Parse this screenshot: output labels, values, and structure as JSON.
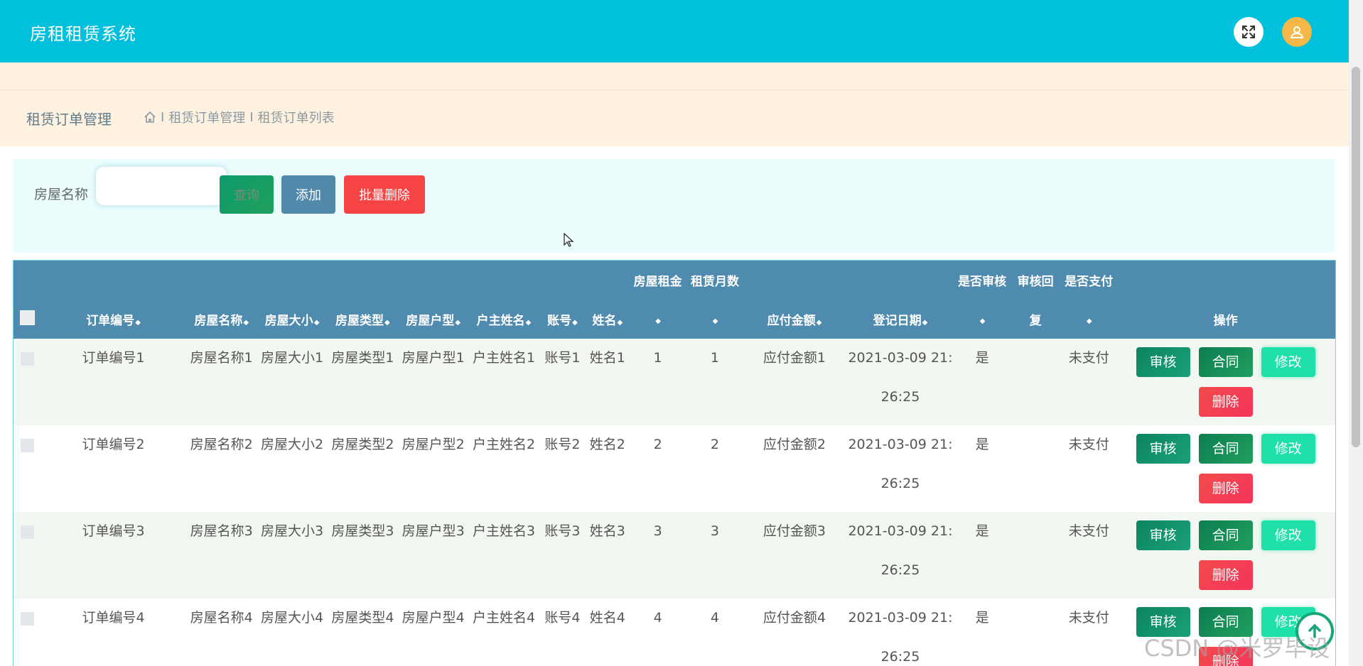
{
  "header": {
    "app_title": "房租租赁系统",
    "fullscreen_icon": "expand-icon",
    "user_icon": "user-icon",
    "accent_color": "#00c0dc"
  },
  "breadcrumb": {
    "page_heading": "租赁订单管理",
    "home_icon": "home-icon",
    "separator": "I",
    "items": [
      "租赁订单管理",
      "租赁订单列表"
    ]
  },
  "search": {
    "label": "房屋名称",
    "value": "",
    "placeholder": "",
    "query_label": "查询",
    "add_label": "添加",
    "batch_delete_label": "批量删除"
  },
  "table": {
    "columns": [
      {
        "label": "订单编号",
        "sortable": true
      },
      {
        "label": "房屋名称",
        "sortable": true
      },
      {
        "label": "房屋大小",
        "sortable": true
      },
      {
        "label": "房屋类型",
        "sortable": true
      },
      {
        "label": "房屋户型",
        "sortable": true
      },
      {
        "label": "户主姓名",
        "sortable": true
      },
      {
        "label": "账号",
        "sortable": true
      },
      {
        "label": "姓名",
        "sortable": true
      },
      {
        "label_top": "房屋租金",
        "sortable": true
      },
      {
        "label_top": "租赁月数",
        "sortable": true
      },
      {
        "label": "应付金额",
        "sortable": true
      },
      {
        "label": "登记日期",
        "sortable": true
      },
      {
        "label_top": "是否审核",
        "sortable": true
      },
      {
        "label_top": "审核回",
        "label": "复",
        "sortable": false
      },
      {
        "label_top": "是否支付",
        "sortable": true
      },
      {
        "label": "操作",
        "sortable": false
      }
    ],
    "actions": {
      "review": "审核",
      "contract": "合同",
      "edit": "修改",
      "delete": "删除"
    },
    "rows": [
      {
        "order_no": "订单编号1",
        "house_name": "房屋名称1",
        "house_size": "房屋大小1",
        "house_type": "房屋类型1",
        "house_layout": "房屋户型1",
        "owner_name": "户主姓名1",
        "account": "账号1",
        "name": "姓名1",
        "rent": "1",
        "months": "1",
        "amount_due": "应付金额1",
        "reg_date": "2021-03-09 21:26:25",
        "reviewed": "是",
        "review_reply": "",
        "paid": "未支付"
      },
      {
        "order_no": "订单编号2",
        "house_name": "房屋名称2",
        "house_size": "房屋大小2",
        "house_type": "房屋类型2",
        "house_layout": "房屋户型2",
        "owner_name": "户主姓名2",
        "account": "账号2",
        "name": "姓名2",
        "rent": "2",
        "months": "2",
        "amount_due": "应付金额2",
        "reg_date": "2021-03-09 21:26:25",
        "reviewed": "是",
        "review_reply": "",
        "paid": "未支付"
      },
      {
        "order_no": "订单编号3",
        "house_name": "房屋名称3",
        "house_size": "房屋大小3",
        "house_type": "房屋类型3",
        "house_layout": "房屋户型3",
        "owner_name": "户主姓名3",
        "account": "账号3",
        "name": "姓名3",
        "rent": "3",
        "months": "3",
        "amount_due": "应付金额3",
        "reg_date": "2021-03-09 21:26:25",
        "reviewed": "是",
        "review_reply": "",
        "paid": "未支付"
      },
      {
        "order_no": "订单编号4",
        "house_name": "房屋名称4",
        "house_size": "房屋大小4",
        "house_type": "房屋类型4",
        "house_layout": "房屋户型4",
        "owner_name": "户主姓名4",
        "account": "账号4",
        "name": "姓名4",
        "rent": "4",
        "months": "4",
        "amount_due": "应付金额4",
        "reg_date": "2021-03-09 21:26:25",
        "reviewed": "是",
        "review_reply": "",
        "paid": "未支付"
      }
    ]
  },
  "watermark": "CSDN @米罗毕设",
  "scroll_top_icon": "arrow-up-icon"
}
